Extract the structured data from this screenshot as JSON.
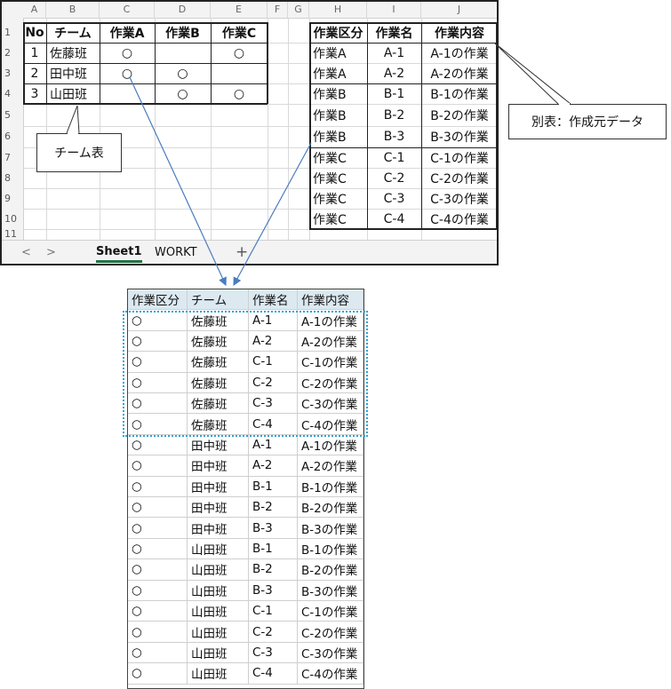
{
  "excel": {
    "columns": [
      "A",
      "B",
      "C",
      "D",
      "E",
      "F",
      "G",
      "H",
      "I",
      "J"
    ],
    "rows": [
      "1",
      "2",
      "3",
      "4",
      "5",
      "6",
      "7",
      "8",
      "9",
      "10",
      "11"
    ],
    "team_table": {
      "headers": [
        "No",
        "チーム",
        "作業A",
        "作業B",
        "作業C"
      ],
      "rows": [
        [
          "1",
          "佐藤班",
          "○",
          "",
          "○"
        ],
        [
          "2",
          "田中班",
          "○",
          "○",
          ""
        ],
        [
          "3",
          "山田班",
          "",
          "○",
          "○"
        ]
      ]
    },
    "work_table": {
      "headers": [
        "作業区分",
        "作業名",
        "作業内容"
      ],
      "rows": [
        [
          "作業A",
          "A-1",
          "A-1の作業"
        ],
        [
          "作業A",
          "A-2",
          "A-2の作業"
        ],
        [
          "作業B",
          "B-1",
          "B-1の作業"
        ],
        [
          "作業B",
          "B-2",
          "B-2の作業"
        ],
        [
          "作業B",
          "B-3",
          "B-3の作業"
        ],
        [
          "作業C",
          "C-1",
          "C-1の作業"
        ],
        [
          "作業C",
          "C-2",
          "C-2の作業"
        ],
        [
          "作業C",
          "C-3",
          "C-3の作業"
        ],
        [
          "作業C",
          "C-4",
          "C-4の作業"
        ]
      ]
    },
    "tabs": {
      "nav_prev": "<",
      "nav_next": ">",
      "sheet1": "Sheet1",
      "workt": "WORKT",
      "add": "+"
    }
  },
  "callouts": {
    "team_table": "チーム表",
    "work_table": "別表：作成元データ"
  },
  "result": {
    "headers": [
      "作業区分",
      "チーム",
      "作業名",
      "作業内容"
    ],
    "rows": [
      [
        "○",
        "佐藤班",
        "A-1",
        "A-1の作業"
      ],
      [
        "○",
        "佐藤班",
        "A-2",
        "A-2の作業"
      ],
      [
        "○",
        "佐藤班",
        "C-1",
        "C-1の作業"
      ],
      [
        "○",
        "佐藤班",
        "C-2",
        "C-2の作業"
      ],
      [
        "○",
        "佐藤班",
        "C-3",
        "C-3の作業"
      ],
      [
        "○",
        "佐藤班",
        "C-4",
        "C-4の作業"
      ],
      [
        "○",
        "田中班",
        "A-1",
        "A-1の作業"
      ],
      [
        "○",
        "田中班",
        "A-2",
        "A-2の作業"
      ],
      [
        "○",
        "田中班",
        "B-1",
        "B-1の作業"
      ],
      [
        "○",
        "田中班",
        "B-2",
        "B-2の作業"
      ],
      [
        "○",
        "田中班",
        "B-3",
        "B-3の作業"
      ],
      [
        "○",
        "山田班",
        "B-1",
        "B-1の作業"
      ],
      [
        "○",
        "山田班",
        "B-2",
        "B-2の作業"
      ],
      [
        "○",
        "山田班",
        "B-3",
        "B-3の作業"
      ],
      [
        "○",
        "山田班",
        "C-1",
        "C-1の作業"
      ],
      [
        "○",
        "山田班",
        "C-2",
        "C-2の作業"
      ],
      [
        "○",
        "山田班",
        "C-3",
        "C-3の作業"
      ],
      [
        "○",
        "山田班",
        "C-4",
        "C-4の作業"
      ]
    ]
  },
  "colors": {
    "arrow": "#4a7cc0",
    "dashed_highlight": "#2fa4d8",
    "result_header_bg": "#dce9f1",
    "active_tab_underline": "#217346"
  }
}
